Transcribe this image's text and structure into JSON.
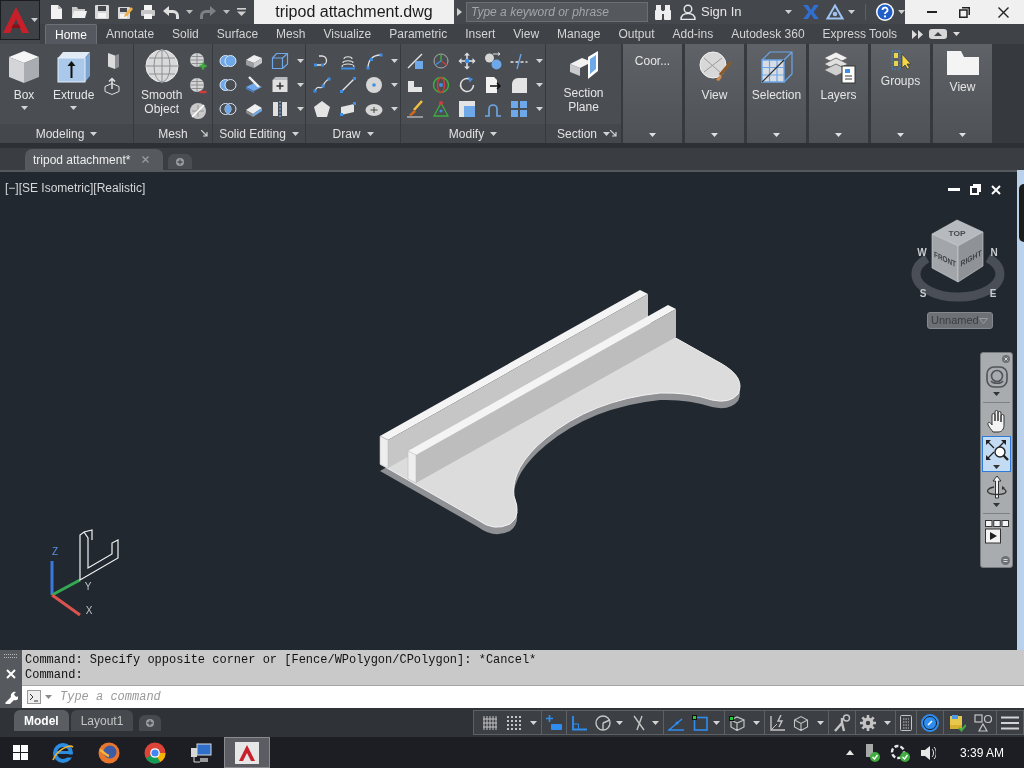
{
  "title_bar": {
    "title": "tripod attachment.dwg",
    "search": {
      "placeholder": "Type a keyword or phrase"
    },
    "sign_in": "Sign In"
  },
  "ribbon": {
    "tabs": [
      {
        "label": "Home",
        "selected": true
      },
      {
        "label": "Annotate",
        "selected": false
      },
      {
        "label": "Solid",
        "selected": false
      },
      {
        "label": "Surface",
        "selected": false
      },
      {
        "label": "Mesh",
        "selected": false
      },
      {
        "label": "Visualize",
        "selected": false
      },
      {
        "label": "Parametric",
        "selected": false
      },
      {
        "label": "Insert",
        "selected": false
      },
      {
        "label": "View",
        "selected": false
      },
      {
        "label": "Manage",
        "selected": false
      },
      {
        "label": "Output",
        "selected": false
      },
      {
        "label": "Add-ins",
        "selected": false
      },
      {
        "label": "Autodesk 360",
        "selected": false
      },
      {
        "label": "Express Tools",
        "selected": false
      }
    ],
    "panels": [
      {
        "kind": "full",
        "title": "Modeling",
        "has_menu": true,
        "has_launcher": false,
        "buttons": [
          {
            "label": "Box",
            "has_menu": true
          },
          {
            "label": "Extrude",
            "has_menu": true
          }
        ]
      },
      {
        "kind": "full",
        "title": "Mesh",
        "has_menu": false,
        "has_launcher": true,
        "buttons": [
          {
            "label": "Smooth Object",
            "has_menu": false
          }
        ]
      },
      {
        "kind": "full",
        "title": "Solid Editing",
        "has_menu": true,
        "has_launcher": false
      },
      {
        "kind": "full",
        "title": "Draw",
        "has_menu": true,
        "has_launcher": false
      },
      {
        "kind": "full",
        "title": "Modify",
        "has_menu": true,
        "has_launcher": false
      },
      {
        "kind": "full",
        "title": "Section",
        "has_menu": true,
        "has_launcher": true,
        "buttons": [
          {
            "label": "Section Plane",
            "has_menu": false
          }
        ]
      },
      {
        "kind": "collapsed",
        "label": "Coor..."
      },
      {
        "kind": "collapsed",
        "label": "View"
      },
      {
        "kind": "collapsed",
        "label": "Selection"
      },
      {
        "kind": "collapsed",
        "label": "Layers"
      },
      {
        "kind": "collapsed",
        "label": "Groups"
      },
      {
        "kind": "collapsed",
        "label": "View"
      }
    ]
  },
  "file_tabs": [
    {
      "label": "tripod attachment*",
      "selected": true
    }
  ],
  "viewport": {
    "label": "[−][SE Isometric][Realistic]",
    "viewcube": {
      "faces": [
        "TOP",
        "FRONT",
        "RIGHT"
      ],
      "compass": [
        "W",
        "N",
        "S",
        "E"
      ],
      "view_name": "Unnamed"
    },
    "navigation_bar": {
      "tools": [
        {
          "selected": false
        },
        {
          "selected": false
        },
        {
          "selected": true
        },
        {
          "selected": false
        },
        {
          "selected": false
        }
      ]
    },
    "ucs_axes": [
      "Z",
      "Y",
      "X"
    ]
  },
  "command_line": {
    "history": [
      "Command: Specify opposite corner or [Fence/WPolygon/CPolygon]: *Cancel*",
      "Command:"
    ],
    "input": {
      "placeholder": "Type a command"
    }
  },
  "layout_tabs": [
    {
      "label": "Model",
      "selected": true
    },
    {
      "label": "Layout1",
      "selected": false
    }
  ],
  "status_bar": {
    "toggles": [
      {
        "on": false
      },
      {
        "on": false
      },
      {
        "on": true
      },
      {
        "on": true
      },
      {
        "on": false
      },
      {
        "on": false
      },
      {
        "on": true
      },
      {
        "on": true
      },
      {
        "on": false
      },
      {
        "on": false
      },
      {
        "on": true
      }
    ]
  },
  "taskbar": {
    "apps": [
      {
        "selected": false
      },
      {
        "selected": false
      },
      {
        "selected": false
      },
      {
        "selected": false
      },
      {
        "selected": true
      }
    ],
    "clock": "3:39 AM"
  }
}
